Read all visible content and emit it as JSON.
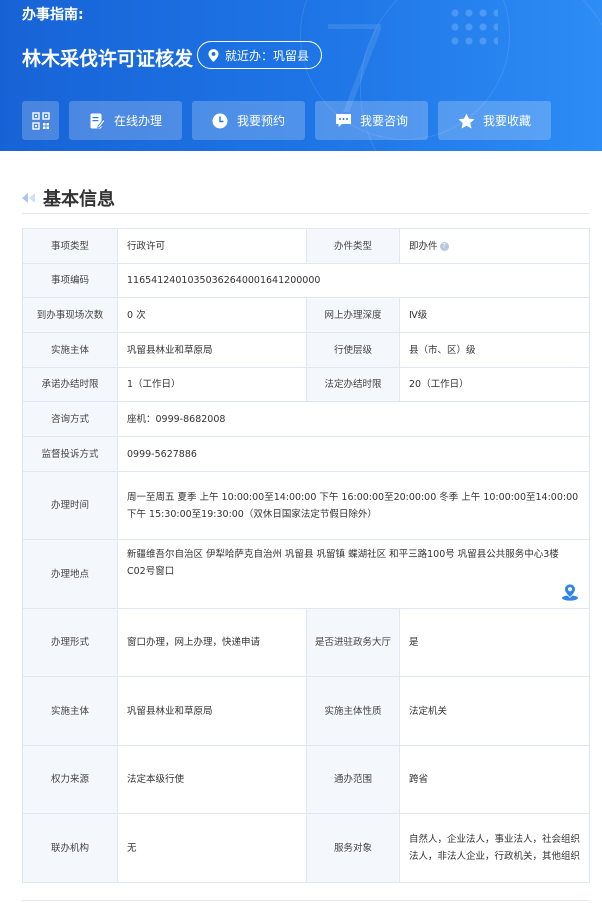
{
  "header": {
    "hint": "办事指南:",
    "title": "林木采伐许可证核发",
    "location": "就近办：巩留县",
    "actions": [
      {
        "label": "在线办理",
        "icon": "edit-icon"
      },
      {
        "label": "我要预约",
        "icon": "clock-icon"
      },
      {
        "label": "我要咨询",
        "icon": "chat-icon"
      },
      {
        "label": "我要收藏",
        "icon": "star-icon"
      }
    ]
  },
  "section": {
    "title": "基本信息"
  },
  "info": {
    "item_type_k": "事项类型",
    "item_type_v": "行政许可",
    "handle_type_k": "办件类型",
    "handle_type_v": "即办件",
    "code_k": "事项编码",
    "code_v": "11654124010350362640001641200000",
    "visits_k": "到办事现场次数",
    "visits_v": "0 次",
    "online_depth_k": "网上办理深度",
    "online_depth_v": "Ⅳ级",
    "subject_k": "实施主体",
    "subject_v": "巩留县林业和草原局",
    "level_k": "行使层级",
    "level_v": "县（市、区）级",
    "promise_k": "承诺办结时限",
    "promise_v": "1（工作日）",
    "legal_k": "法定办结时限",
    "legal_v": "20（工作日）",
    "consult_k": "咨询方式",
    "consult_v": "座机：0999-8682008",
    "complaint_k": "监督投诉方式",
    "complaint_v": "0999-5627886",
    "time_k": "办理时间",
    "time_v": "周一至周五 夏季 上午 10:00:00至14:00:00 下午 16:00:00至20:00:00 冬季 上午 10:00:00至14:00:00 下午 15:30:00至19:30:00（双休日国家法定节假日除外）",
    "place_k": "办理地点",
    "place_v": "新疆维吾尔自治区 伊犁哈萨克自治州 巩留县 巩留镇 蝶湖社区 和平三路100号 巩留县公共服务中心3楼 C02号窗口",
    "form_k": "办理形式",
    "form_v": "窗口办理，网上办理，快递申请",
    "hall_k": "是否进驻政务大厅",
    "hall_v": "是",
    "subject2_k": "实施主体",
    "subject2_v": "巩留县林业和草原局",
    "nature_k": "实施主体性质",
    "nature_v": "法定机关",
    "power_k": "权力来源",
    "power_v": "法定本级行使",
    "scope_k": "通办范围",
    "scope_v": "跨省",
    "joint_k": "联办机构",
    "joint_v": "无",
    "target_k": "服务对象",
    "target_v": "自然人，企业法人，事业法人，社会组织法人，非法人企业，行政机关，其他组织"
  },
  "colors": {
    "header_blue": "#1f76e6",
    "label_bg": "#f4f8fd",
    "border": "#dfe7f2"
  }
}
